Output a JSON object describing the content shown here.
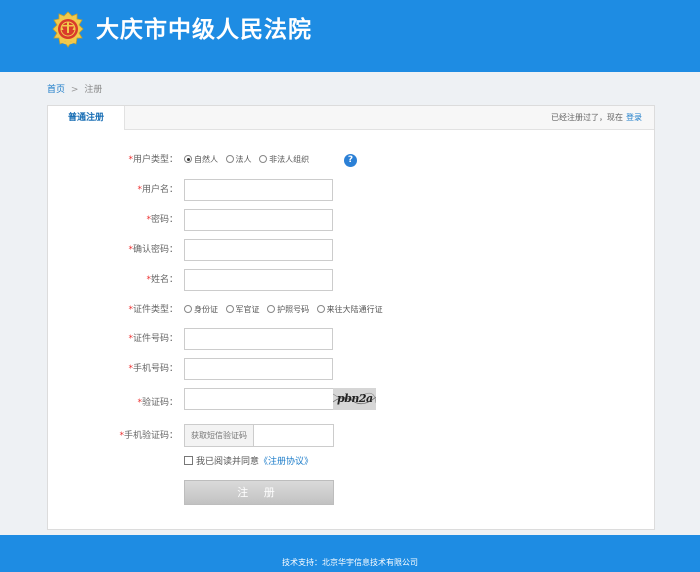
{
  "header": {
    "court_name": "大庆市中级人民法院"
  },
  "breadcrumb": {
    "home": "首页",
    "separator": ">",
    "current": "注册"
  },
  "panel": {
    "tab_label": "普通注册",
    "login_prompt": "已经注册过了，现在",
    "login_link": "登录"
  },
  "form": {
    "required_mark": "*",
    "user_type": {
      "label": "用户类型：",
      "options": [
        "自然人",
        "法人",
        "非法人组织"
      ],
      "selected": "自然人"
    },
    "username_label": "用户名：",
    "password_label": "密码：",
    "confirm_password_label": "确认密码：",
    "name_label": "姓名：",
    "id_type": {
      "label": "证件类型：",
      "options": [
        "身份证",
        "军官证",
        "护照号码",
        "来往大陆通行证"
      ],
      "selected": null
    },
    "id_number_label": "证件号码：",
    "phone_label": "手机号码：",
    "captcha_label": "验证码：",
    "captcha_image_text": "pbn2a",
    "sms_code_label": "手机验证码：",
    "sms_button": "获取短信验证码",
    "agree_text": "我已阅读并同意",
    "agreement_link": "《注册协议》",
    "submit_label": "注 册"
  },
  "footer": {
    "text": "技术支持：北京华宇信息技术有限公司"
  },
  "colors": {
    "brand_blue": "#1e8ce3",
    "link_blue": "#1a7bc9",
    "required_red": "#ee3333"
  }
}
